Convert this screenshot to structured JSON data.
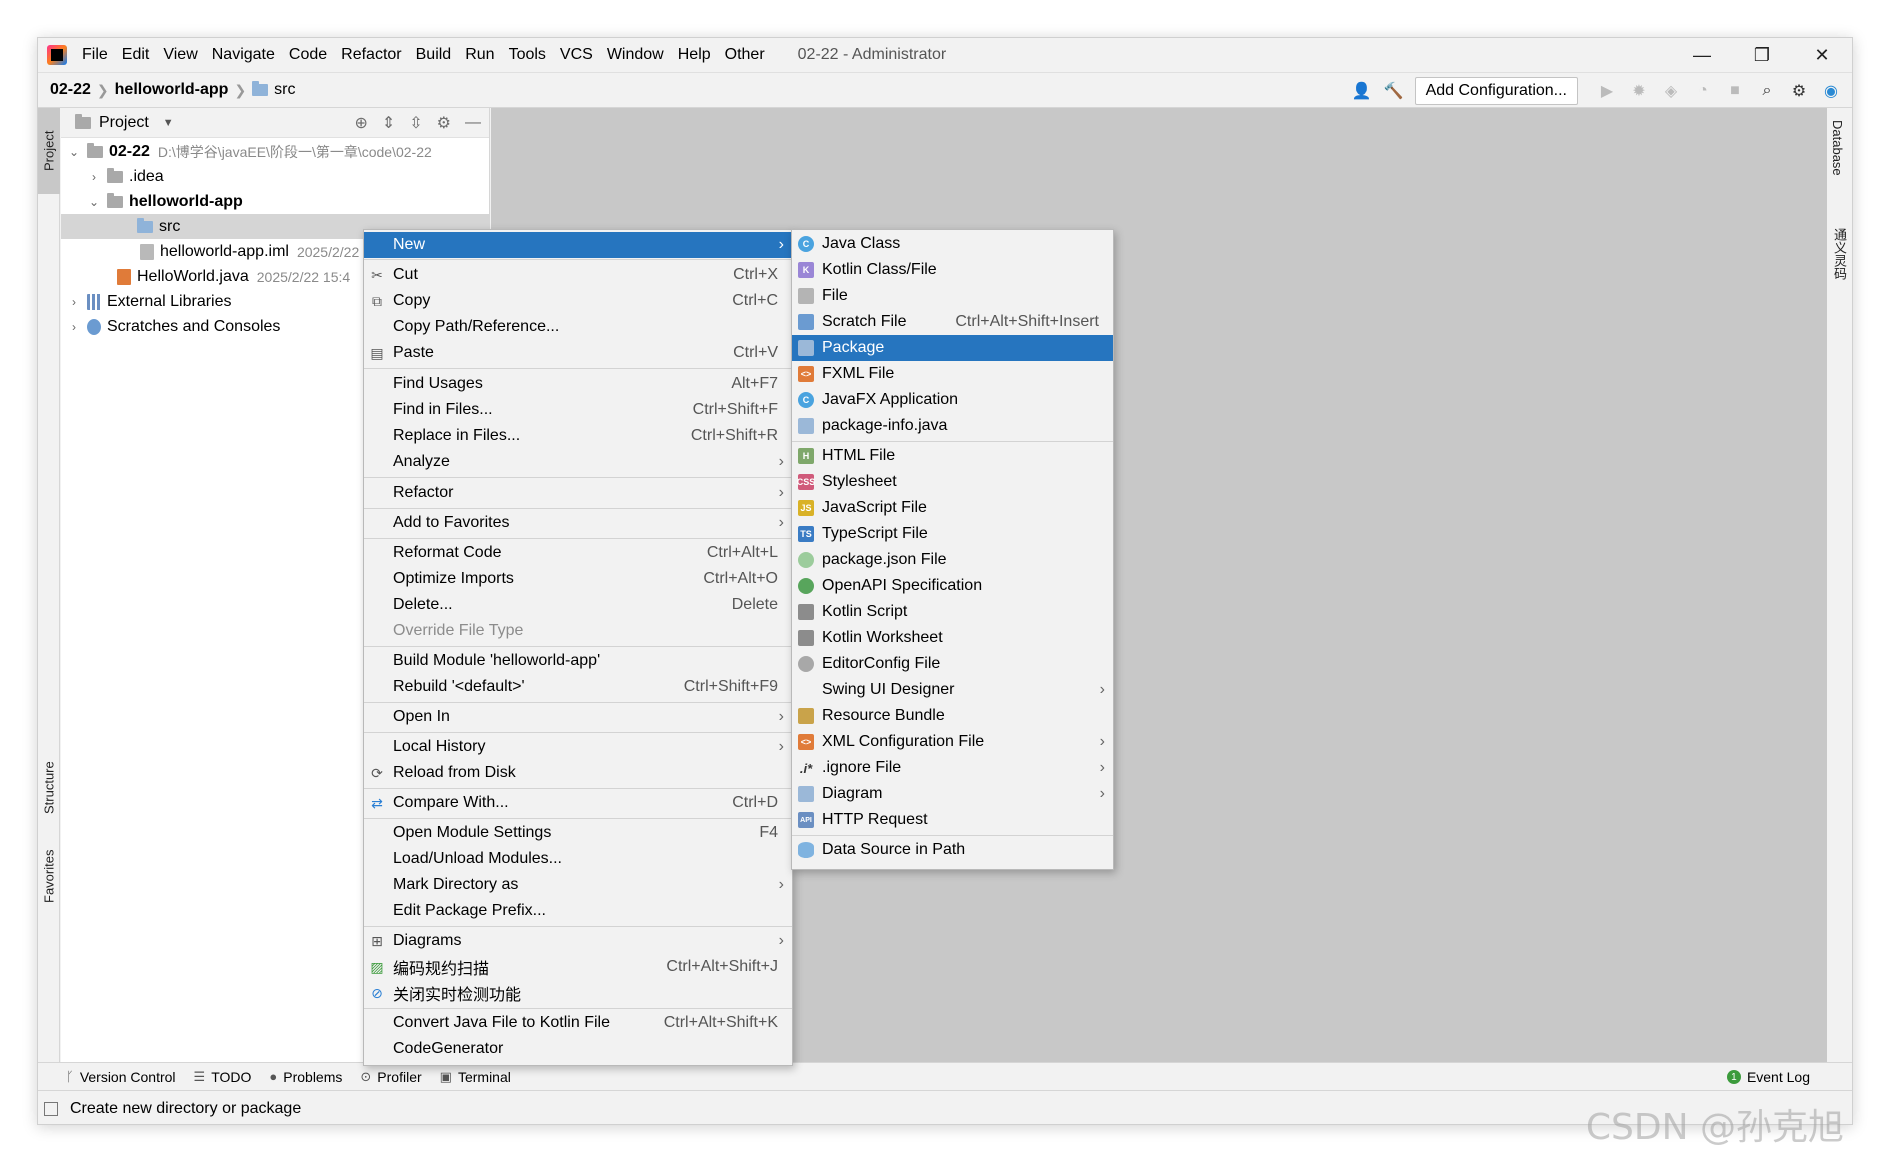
{
  "titlebar": {
    "menu": [
      "File",
      "Edit",
      "View",
      "Navigate",
      "Code",
      "Refactor",
      "Build",
      "Run",
      "Tools",
      "VCS",
      "Window",
      "Help",
      "Other"
    ],
    "window_title": "02-22 - Administrator",
    "controls": [
      "—",
      "❐",
      "✕"
    ]
  },
  "navbar": {
    "crumbs": [
      "02-22",
      "helloworld-app",
      "src"
    ],
    "add_configuration": "Add Configuration..."
  },
  "left_stripe": {
    "project": "Project",
    "structure": "Structure",
    "favorites": "Favorites"
  },
  "right_stripe": {
    "database": "Database",
    "other": "通义灵码"
  },
  "project_panel": {
    "title": "Project",
    "tree": [
      {
        "name": "02-22",
        "meta": "D:\\博学谷\\javaEE\\阶段一\\第一章\\code\\02-22"
      },
      {
        "name": ".idea",
        "meta": ""
      },
      {
        "name": "helloworld-app",
        "meta": ""
      },
      {
        "name": "src",
        "meta": ""
      },
      {
        "name": "helloworld-app.iml",
        "meta": "2025/2/22"
      },
      {
        "name": "HelloWorld.java",
        "meta": "2025/2/22 15:4"
      },
      {
        "name": "External Libraries",
        "meta": ""
      },
      {
        "name": "Scratches and Consoles",
        "meta": ""
      }
    ]
  },
  "context_menu": {
    "items": [
      {
        "label": "New",
        "shortcut": "",
        "submenu": true
      },
      {
        "label": "Cut",
        "shortcut": "Ctrl+X"
      },
      {
        "label": "Copy",
        "shortcut": "Ctrl+C"
      },
      {
        "label": "Copy Path/Reference...",
        "shortcut": ""
      },
      {
        "label": "Paste",
        "shortcut": "Ctrl+V"
      },
      {
        "label": "Find Usages",
        "shortcut": "Alt+F7"
      },
      {
        "label": "Find in Files...",
        "shortcut": "Ctrl+Shift+F"
      },
      {
        "label": "Replace in Files...",
        "shortcut": "Ctrl+Shift+R"
      },
      {
        "label": "Analyze",
        "shortcut": "",
        "submenu": true
      },
      {
        "label": "Refactor",
        "shortcut": "",
        "submenu": true
      },
      {
        "label": "Add to Favorites",
        "shortcut": "",
        "submenu": true
      },
      {
        "label": "Reformat Code",
        "shortcut": "Ctrl+Alt+L"
      },
      {
        "label": "Optimize Imports",
        "shortcut": "Ctrl+Alt+O"
      },
      {
        "label": "Delete...",
        "shortcut": "Delete"
      },
      {
        "label": "Override File Type",
        "shortcut": ""
      },
      {
        "label": "Build Module 'helloworld-app'",
        "shortcut": ""
      },
      {
        "label": "Rebuild '<default>'",
        "shortcut": "Ctrl+Shift+F9"
      },
      {
        "label": "Open In",
        "shortcut": "",
        "submenu": true
      },
      {
        "label": "Local History",
        "shortcut": "",
        "submenu": true
      },
      {
        "label": "Reload from Disk",
        "shortcut": ""
      },
      {
        "label": "Compare With...",
        "shortcut": "Ctrl+D"
      },
      {
        "label": "Open Module Settings",
        "shortcut": "F4"
      },
      {
        "label": "Load/Unload Modules...",
        "shortcut": ""
      },
      {
        "label": "Mark Directory as",
        "shortcut": "",
        "submenu": true
      },
      {
        "label": "Edit Package Prefix...",
        "shortcut": ""
      },
      {
        "label": "Diagrams",
        "shortcut": "",
        "submenu": true
      },
      {
        "label": "编码规约扫描",
        "shortcut": "Ctrl+Alt+Shift+J"
      },
      {
        "label": "关闭实时检测功能",
        "shortcut": ""
      },
      {
        "label": "Convert Java File to Kotlin File",
        "shortcut": "Ctrl+Alt+Shift+K"
      },
      {
        "label": "CodeGenerator",
        "shortcut": ""
      }
    ]
  },
  "new_submenu": {
    "items": [
      {
        "label": "Java Class",
        "shortcut": ""
      },
      {
        "label": "Kotlin Class/File",
        "shortcut": ""
      },
      {
        "label": "File",
        "shortcut": ""
      },
      {
        "label": "Scratch File",
        "shortcut": "Ctrl+Alt+Shift+Insert"
      },
      {
        "label": "Package",
        "shortcut": ""
      },
      {
        "label": "FXML File",
        "shortcut": ""
      },
      {
        "label": "JavaFX Application",
        "shortcut": ""
      },
      {
        "label": "package-info.java",
        "shortcut": ""
      },
      {
        "label": "HTML File",
        "shortcut": ""
      },
      {
        "label": "Stylesheet",
        "shortcut": ""
      },
      {
        "label": "JavaScript File",
        "shortcut": ""
      },
      {
        "label": "TypeScript File",
        "shortcut": ""
      },
      {
        "label": "package.json File",
        "shortcut": ""
      },
      {
        "label": "OpenAPI Specification",
        "shortcut": ""
      },
      {
        "label": "Kotlin Script",
        "shortcut": ""
      },
      {
        "label": "Kotlin Worksheet",
        "shortcut": ""
      },
      {
        "label": "EditorConfig File",
        "shortcut": ""
      },
      {
        "label": "Swing UI Designer",
        "shortcut": "",
        "submenu": true
      },
      {
        "label": "Resource Bundle",
        "shortcut": ""
      },
      {
        "label": "XML Configuration File",
        "shortcut": "",
        "submenu": true
      },
      {
        "label": ".ignore File",
        "shortcut": "",
        "submenu": true
      },
      {
        "label": "Diagram",
        "shortcut": "",
        "submenu": true
      },
      {
        "label": "HTTP Request",
        "shortcut": ""
      },
      {
        "label": "Data Source in Path",
        "shortcut": ""
      }
    ]
  },
  "bottom_tabs": [
    "Version Control",
    "TODO",
    "Problems",
    "Profiler",
    "Terminal"
  ],
  "event_log": "Event Log",
  "status": "Create new directory or package",
  "watermark": "CSDN @孙克旭",
  "colors": {
    "selection": "#2675bf",
    "background": "#f2f2f2"
  }
}
